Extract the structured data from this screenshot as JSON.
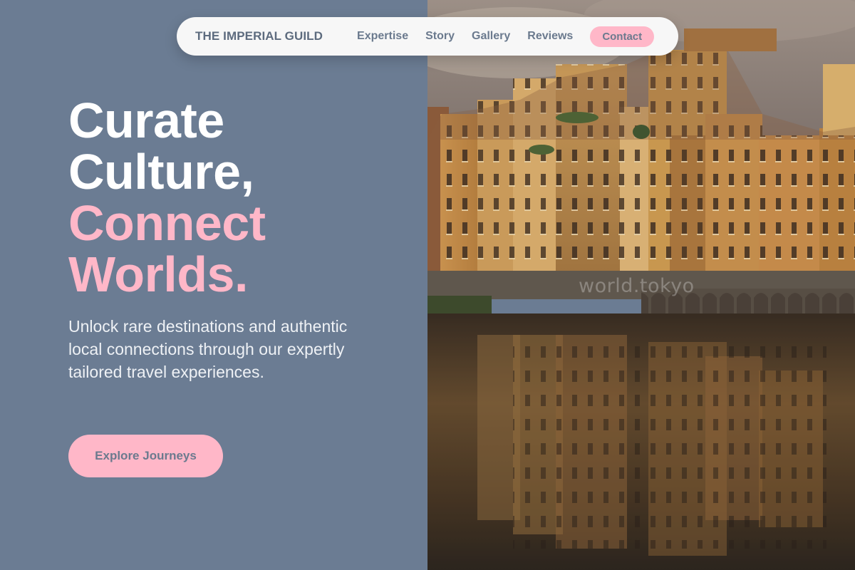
{
  "nav": {
    "brand": "THE IMPERIAL GUILD",
    "links": [
      "Expertise",
      "Story",
      "Gallery",
      "Reviews"
    ],
    "contact": "Contact"
  },
  "hero": {
    "title_line1": "Curate",
    "title_line2": "Culture,",
    "title_line3": "Connect",
    "title_line4": "Worlds.",
    "subtitle": "Unlock rare destinations and authentic local connections through our expertly tailored travel experiences.",
    "cta": "Explore Journeys"
  },
  "image": {
    "watermark": "world.tokyo",
    "subject": "riverside buildings reflected in river at dusk"
  },
  "colors": {
    "left_panel": "#6b7c93",
    "accent_pink": "#ffb7c8",
    "nav_bg": "#f7f7f7",
    "nav_text": "#6b7a8e"
  }
}
